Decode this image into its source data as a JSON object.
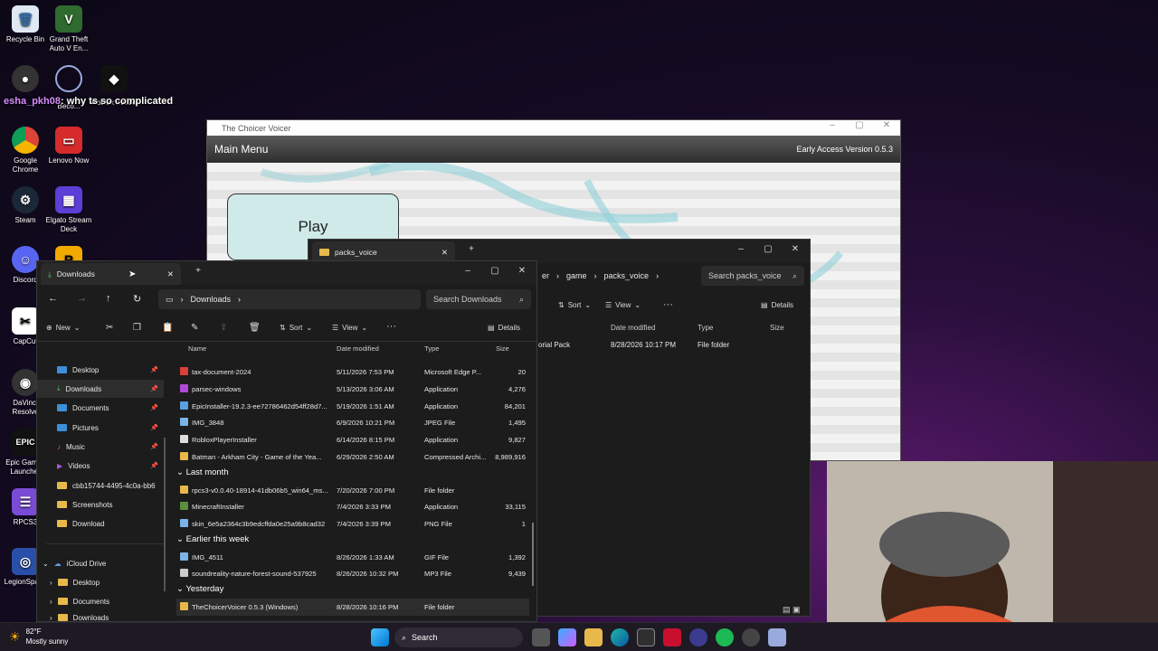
{
  "desktop": {
    "icons": [
      {
        "label": "Recycle Bin"
      },
      {
        "label": "Grand Theft Auto V En..."
      },
      {
        "label": "OBS Studio"
      },
      {
        "label": "Beco..."
      },
      {
        "label": "Roblox Studio"
      },
      {
        "label": "Google Chrome"
      },
      {
        "label": "Lenovo Now"
      },
      {
        "label": "Steam"
      },
      {
        "label": "Elgato Stream Deck"
      },
      {
        "label": "Discord"
      },
      {
        "label": "CapCut"
      },
      {
        "label": "DaVinci Resolve"
      },
      {
        "label": "Epic Games Launcher"
      },
      {
        "label": "RPCS3"
      },
      {
        "label": "LegionSpace"
      }
    ],
    "chat_overlay": {
      "user": "esha_pkh08",
      "message": ": why ts so complicated"
    }
  },
  "game_window": {
    "title": "The Choicer Voicer",
    "menu_label": "Main Menu",
    "version": "Early Access Version 0.5.3",
    "play_label": "Play"
  },
  "explorer_back": {
    "tab_title": "packs_voice",
    "breadcrumb": [
      "er",
      "game",
      "packs_voice"
    ],
    "search_placeholder": "Search packs_voice",
    "sort_label": "Sort",
    "view_label": "View",
    "details_label": "Details",
    "columns": [
      "Date modified",
      "Type",
      "Size"
    ],
    "rows": [
      {
        "name": "orial Pack",
        "date": "8/28/2026 10:17 PM",
        "type": "File folder",
        "size": ""
      }
    ]
  },
  "explorer": {
    "tab_title": "Downloads",
    "location": "Downloads",
    "search_placeholder": "Search Downloads",
    "new_label": "New",
    "sort_label": "Sort",
    "view_label": "View",
    "details_label": "Details",
    "columns": {
      "name": "Name",
      "date": "Date modified",
      "type": "Type",
      "size": "Size"
    },
    "sidebar": [
      {
        "label": "Desktop"
      },
      {
        "label": "Downloads"
      },
      {
        "label": "Documents"
      },
      {
        "label": "Pictures"
      },
      {
        "label": "Music"
      },
      {
        "label": "Videos"
      },
      {
        "label": "cbb15744-4495-4c0a-bb6"
      },
      {
        "label": "Screenshots"
      },
      {
        "label": "Download"
      }
    ],
    "icloud": {
      "label": "iCloud Drive",
      "children": [
        "Desktop",
        "Documents",
        "Downloads"
      ]
    },
    "rows": [
      {
        "name": "tax-document-2024",
        "date": "5/11/2026 7:53 PM",
        "type": "Microsoft Edge P...",
        "size": "20",
        "color": "#d9413a"
      },
      {
        "name": "parsec-windows",
        "date": "5/13/2026 3:06 AM",
        "type": "Application",
        "size": "4,276",
        "color": "#b04ad6"
      },
      {
        "name": "EpicInstaller-19.2.3-ee72786462d54ff28d7...",
        "date": "5/19/2026 1:51 AM",
        "type": "Application",
        "size": "84,201",
        "color": "#5aa0e0"
      },
      {
        "name": "IMG_3848",
        "date": "6/9/2026 10:21 PM",
        "type": "JPEG File",
        "size": "1,495",
        "color": "#7bb3e6"
      },
      {
        "name": "RobloxPlayerInstaller",
        "date": "6/14/2026 8:15 PM",
        "type": "Application",
        "size": "9,827",
        "color": "#dddddd"
      },
      {
        "name": "Batman - Arkham City - Game of the Yea...",
        "date": "6/29/2026 2:50 AM",
        "type": "Compressed Archi...",
        "size": "8,989,916",
        "color": "#e8b94a"
      }
    ],
    "group_last_month": "Last month",
    "rows_last_month": [
      {
        "name": "rpcs3-v0.0.40-18914-41db06b5_win64_ms...",
        "date": "7/20/2026 7:00 PM",
        "type": "File folder",
        "size": "",
        "color": "#e8b94a"
      },
      {
        "name": "MinecraftInstaller",
        "date": "7/4/2026 3:33 PM",
        "type": "Application",
        "size": "33,115",
        "color": "#5a8f3c"
      },
      {
        "name": "skin_6e5a2364c3b9edcffda0e25a9b8cad32",
        "date": "7/4/2026 3:39 PM",
        "type": "PNG File",
        "size": "1",
        "color": "#7bb3e6"
      }
    ],
    "group_this_week": "Earlier this week",
    "rows_this_week": [
      {
        "name": "IMG_4511",
        "date": "8/26/2026 1:33 AM",
        "type": "GIF File",
        "size": "1,392",
        "color": "#7bb3e6"
      },
      {
        "name": "soundreality-nature-forest-sound-537925",
        "date": "8/26/2026 10:32 PM",
        "type": "MP3 File",
        "size": "9,439",
        "color": "#cccccc"
      }
    ],
    "group_yesterday": "Yesterday",
    "rows_yesterday": [
      {
        "name": "TheChoicerVoicer 0.5.3 (Windows)",
        "date": "8/28/2026 10:16 PM",
        "type": "File folder",
        "size": "",
        "color": "#e8b94a"
      }
    ]
  },
  "taskbar": {
    "weather_temp": "82°F",
    "weather_desc": "Mostly sunny",
    "search_label": "Search"
  }
}
